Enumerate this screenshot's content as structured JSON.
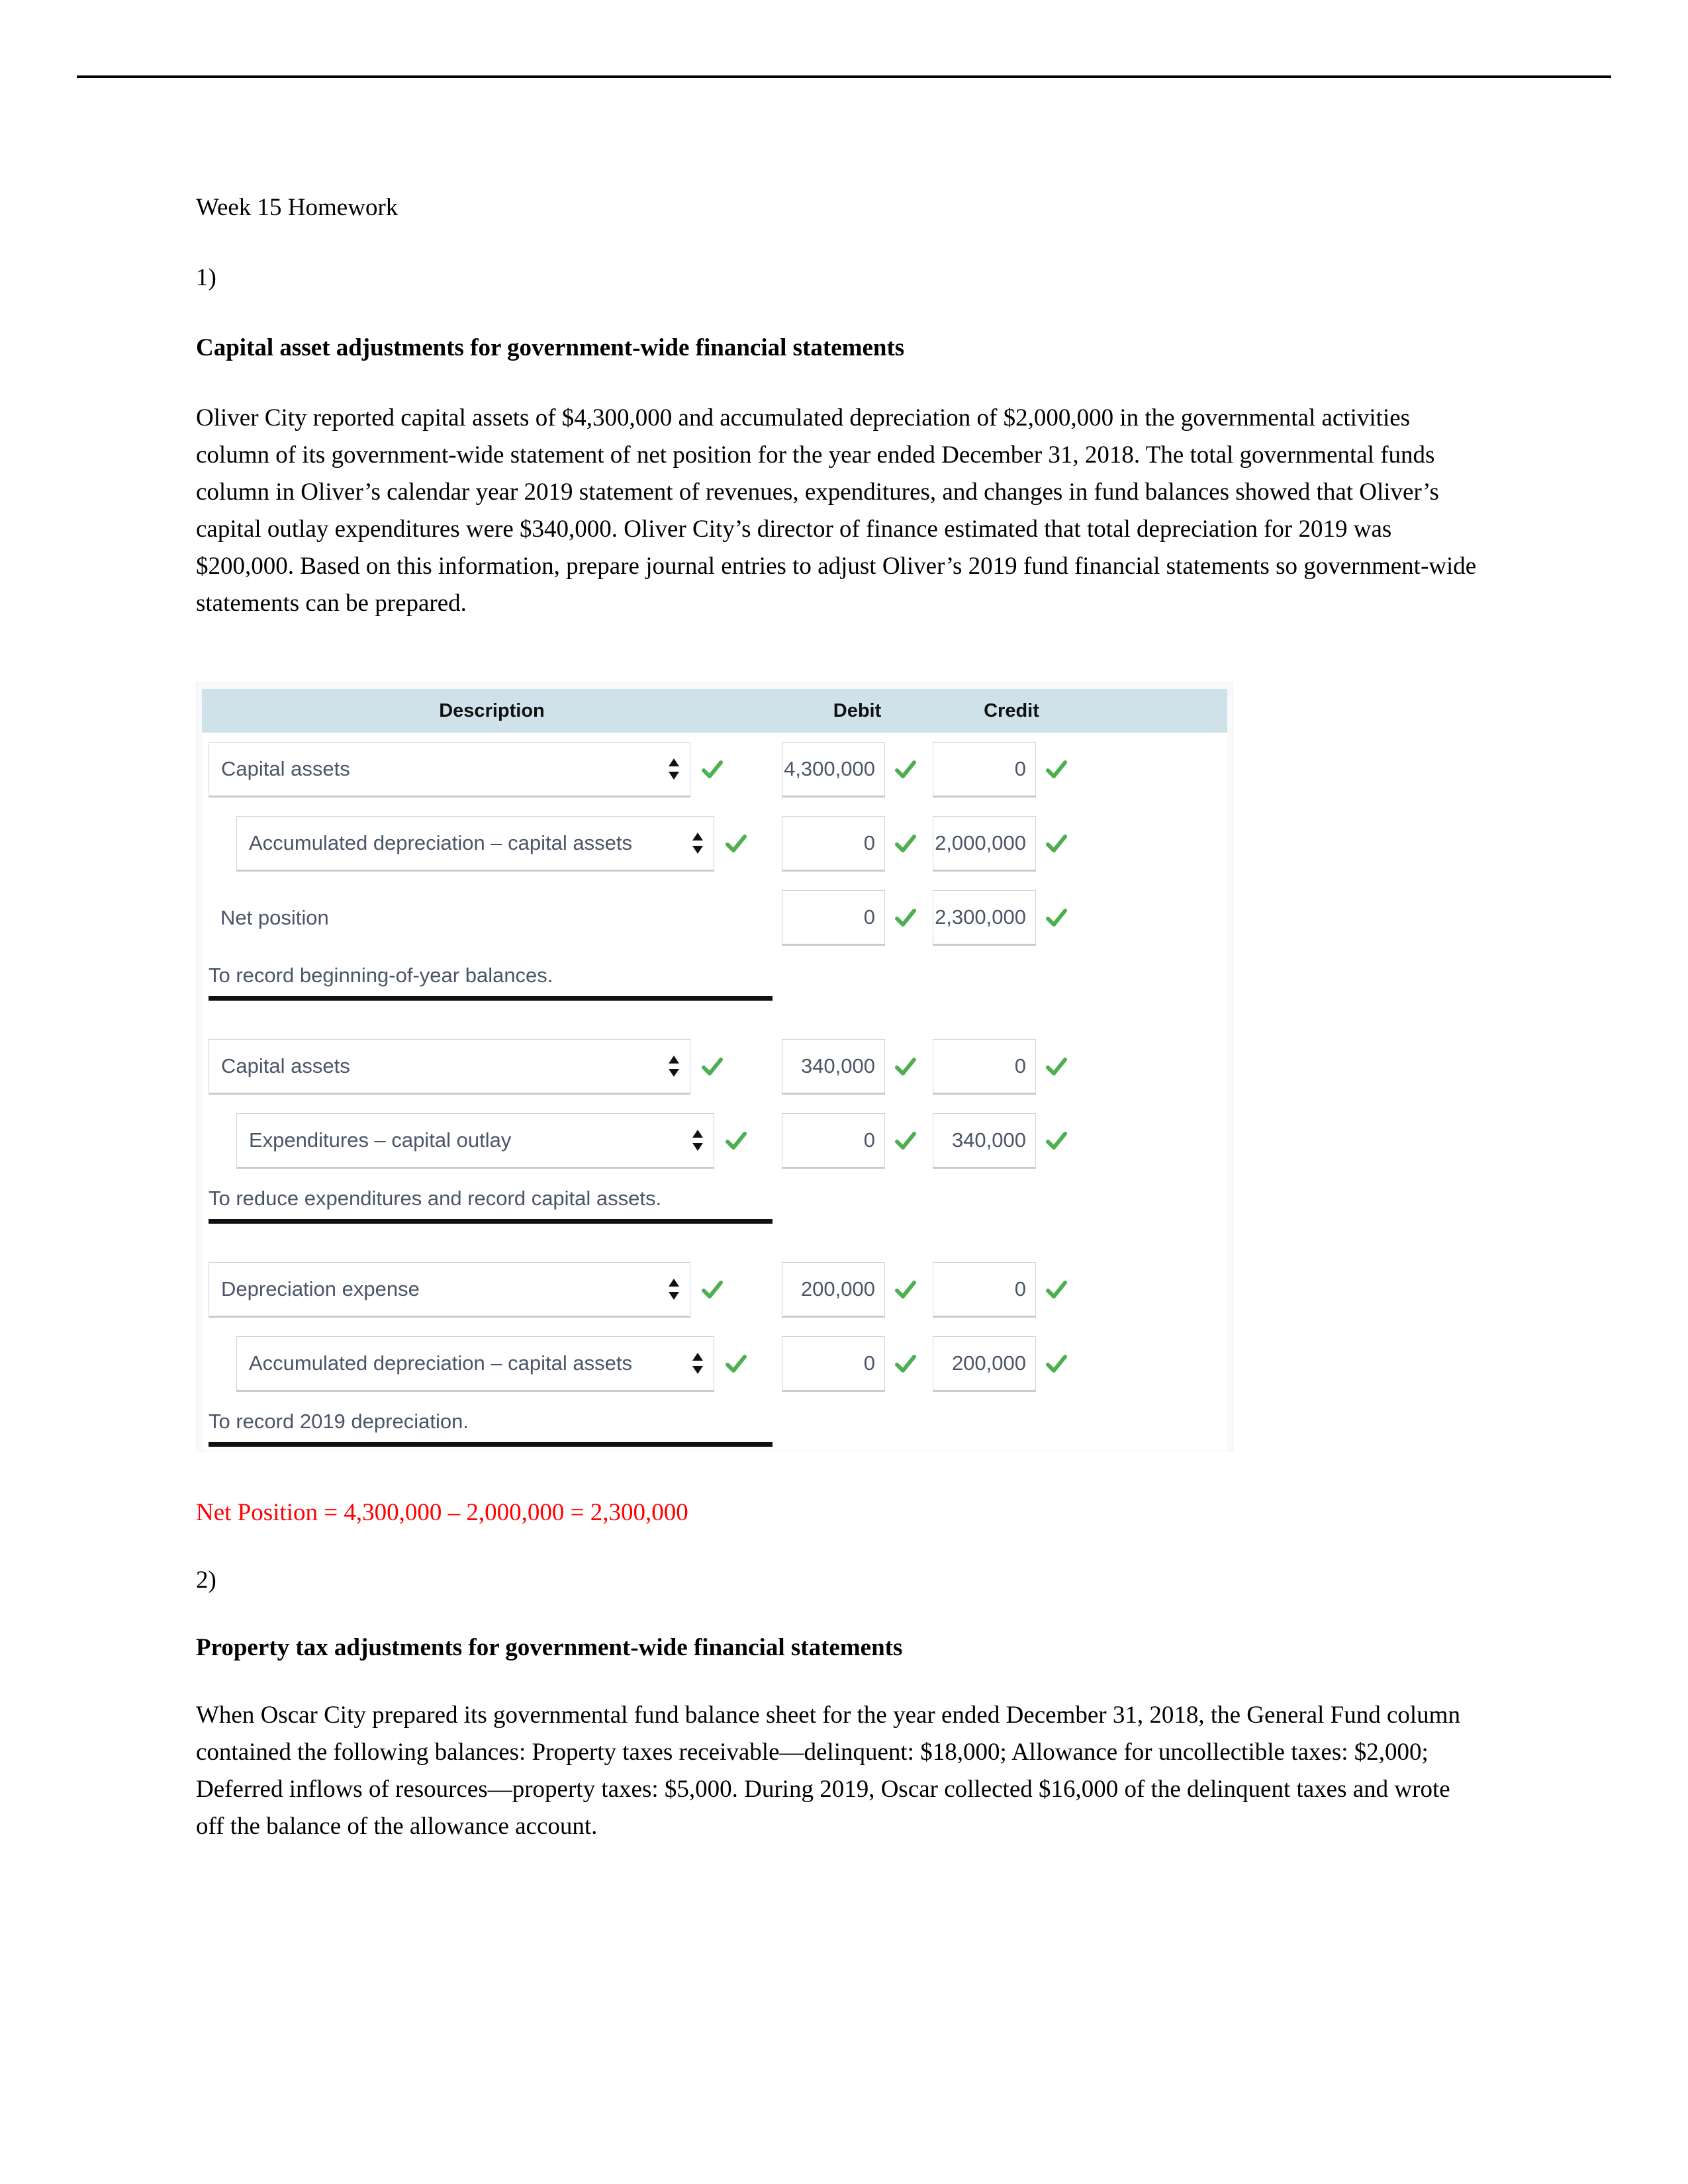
{
  "document": {
    "title": "Week 15 Homework",
    "problem_1_number": "1)",
    "problem_1_heading": "Capital asset adjustments for government-wide financial statements",
    "problem_1_body": "Oliver City reported capital assets of $4,300,000 and accumulated depreciation of $2,000,000 in the governmental activities column of its government-wide statement of net position for the year ended December 31, 2018. The total governmental funds column in Oliver’s calendar year 2019 statement of revenues, expenditures, and changes in fund balances showed that Oliver’s capital outlay expenditures were $340,000. Oliver City’s director of finance estimated that total depreciation for 2019 was $200,000. Based on this information, prepare journal entries to adjust Oliver’s 2019 fund financial statements so government-wide statements can be prepared.",
    "answer_note": "Net Position = 4,300,000 – 2,000,000 = 2,300,000",
    "problem_2_number": "2)",
    "problem_2_heading": "Property tax adjustments for government-wide financial statements",
    "problem_2_body": "When Oscar City prepared its governmental fund balance sheet for the year ended December 31, 2018, the General Fund column contained the following balances: Property taxes receivable—delinquent: $18,000; Allowance for uncollectible taxes: $2,000; Deferred inflows of resources—property taxes: $5,000. During 2019, Oscar collected $16,000 of the delinquent taxes and wrote off the balance of the allowance account."
  },
  "journal_table": {
    "headers": {
      "description": "Description",
      "debit": "Debit",
      "credit": "Credit"
    },
    "colors": {
      "header_background": "#cfe2ea",
      "panel_background": "#f8f9fa",
      "check_green": "#4cb050",
      "field_text": "#4a5568",
      "field_border": "#ced4da",
      "answer_note_red": "#ff0000"
    },
    "entries": [
      {
        "rows": [
          {
            "account": "Capital assets",
            "control": "select",
            "indent": false,
            "debit": "4,300,000",
            "credit": "0",
            "desc_check": true
          },
          {
            "account": "Accumulated depreciation – capital assets",
            "control": "select",
            "indent": true,
            "debit": "0",
            "credit": "2,000,000",
            "desc_check": true
          },
          {
            "account": "Net position",
            "control": "text",
            "indent": true,
            "debit": "0",
            "credit": "2,300,000",
            "desc_check": false
          }
        ],
        "memo": "To record beginning-of-year balances."
      },
      {
        "rows": [
          {
            "account": "Capital assets",
            "control": "select",
            "indent": false,
            "debit": "340,000",
            "credit": "0",
            "desc_check": true
          },
          {
            "account": "Expenditures – capital outlay",
            "control": "select",
            "indent": true,
            "debit": "0",
            "credit": "340,000",
            "desc_check": true
          }
        ],
        "memo": "To reduce expenditures and record capital assets."
      },
      {
        "rows": [
          {
            "account": "Depreciation expense",
            "control": "select",
            "indent": false,
            "debit": "200,000",
            "credit": "0",
            "desc_check": true
          },
          {
            "account": "Accumulated depreciation – capital assets",
            "control": "select",
            "indent": true,
            "debit": "0",
            "credit": "200,000",
            "desc_check": true
          }
        ],
        "memo": "To record 2019 depreciation."
      }
    ]
  }
}
